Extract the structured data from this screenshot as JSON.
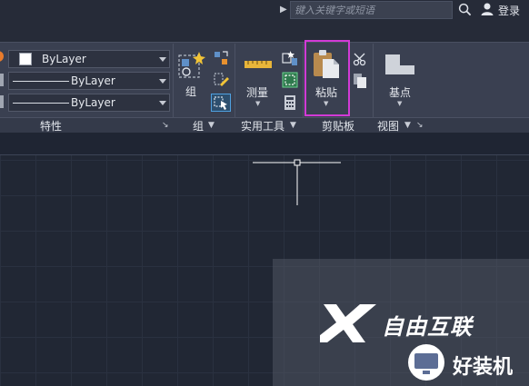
{
  "header": {
    "search_placeholder": "键入关键字或短语",
    "login_label": "登录"
  },
  "properties_panel": {
    "color_value": "ByLayer",
    "linetype_value": "ByLayer",
    "lineweight_value": "ByLayer",
    "title": "特性"
  },
  "groups_panel": {
    "group_button_label": "组",
    "title": "组"
  },
  "utilities_panel": {
    "measure_button_label": "测量",
    "title": "实用工具"
  },
  "clipboard_panel": {
    "paste_button_label": "粘贴",
    "title": "剪贴板"
  },
  "view_panel": {
    "base_point_button_label": "基点",
    "title": "视图"
  },
  "watermark": {
    "brand_top": "自由互联",
    "brand_bottom": "好装机"
  },
  "colors": {
    "highlight": "#d23ad6",
    "ribbon_bg": "#3a4051",
    "canvas_bg": "#212734"
  }
}
